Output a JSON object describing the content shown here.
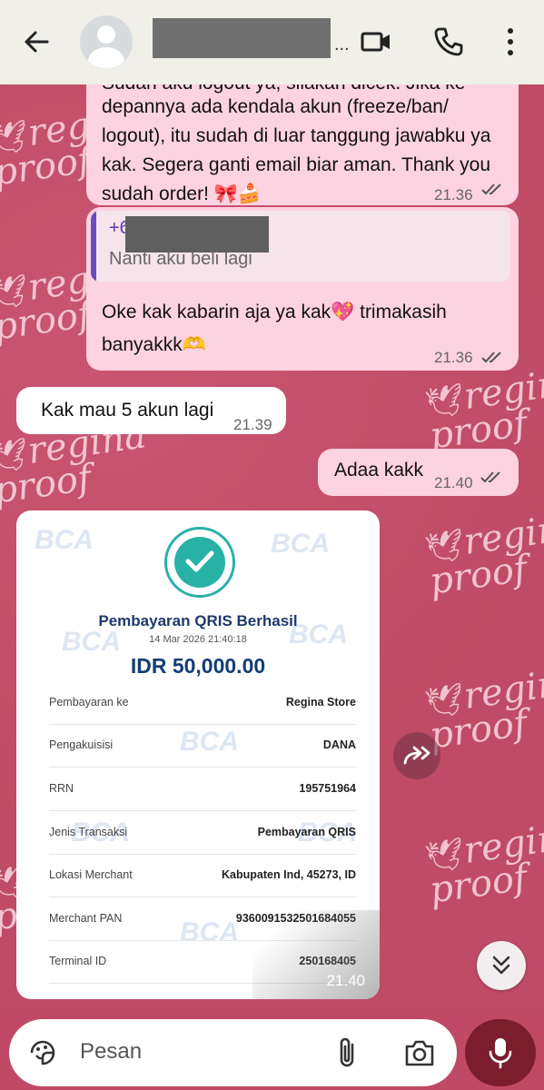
{
  "header": {
    "back_icon": "arrow-left-icon",
    "contact_name_suffix": "...",
    "video_icon": "video-call-icon",
    "call_icon": "phone-icon",
    "menu_icon": "more-vert-icon"
  },
  "background": {
    "watermark_line1": "regina",
    "watermark_line2": "proof"
  },
  "messages": [
    {
      "direction": "out",
      "text_top_cut": "Sudah aku logout ya, silakan dicek. Jika ke",
      "text": "depannya ada kendala akun (freeze/ban/ logout), itu sudah di luar tanggung jawabku ya kak. Segera ganti email biar aman. Thank you sudah order! 🎀🍰",
      "time": "21.36"
    },
    {
      "direction": "out",
      "quote_prefix": "+6",
      "quote_text": "Nanti aku beli lagi",
      "text": "Oke kak kabarin aja ya kak💖 trimakasih banyakkk🫶",
      "time": "21.36"
    },
    {
      "direction": "in",
      "text": "Kak mau 5 akun lagi",
      "time": "21.39"
    },
    {
      "direction": "out",
      "text": "Adaa kakk",
      "time": "21.40"
    }
  ],
  "receipt": {
    "watermark": "BCA",
    "title": "Pembayaran QRIS Berhasil",
    "date": "14 Mar 2026 21:40:18",
    "amount": "IDR 50,000.00",
    "rows": [
      {
        "label": "Pembayaran ke",
        "value": "Regina Store"
      },
      {
        "label": "Pengakuisisi",
        "value": "DANA"
      },
      {
        "label": "RRN",
        "value": "195751964"
      },
      {
        "label": "Jenis Transaksi",
        "value": "Pembayaran QRIS"
      },
      {
        "label": "Lokasi Merchant",
        "value": "Kabupaten Ind, 45273, ID"
      },
      {
        "label": "Merchant PAN",
        "value": "9360091532501684055"
      },
      {
        "label": "Terminal ID",
        "value": "250168405"
      }
    ],
    "time": "21.40"
  },
  "input": {
    "placeholder": "Pesan",
    "emoji_icon": "sticker-icon",
    "attach_icon": "paperclip-icon",
    "camera_icon": "camera-icon",
    "mic_icon": "mic-icon"
  },
  "colors": {
    "chat_bg": "#bf4b66",
    "bubble_out": "#fdd2e1",
    "bubble_in": "#ffffff",
    "header_bg": "#f0efe8",
    "mic_bg": "#7b1d2c",
    "receipt_accent": "#28b2a6"
  }
}
